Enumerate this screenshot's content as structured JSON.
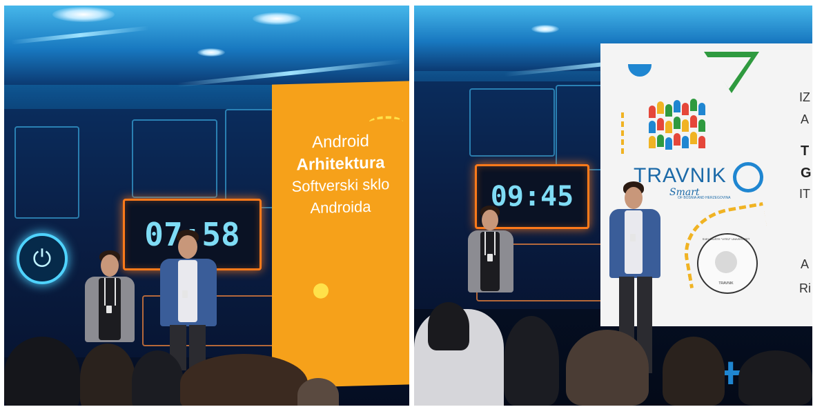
{
  "left_photo": {
    "timer_text": "07:58",
    "slide": {
      "line1": "Android",
      "line2": "Arhitektura",
      "line3": "Softverski sklo",
      "line4": "Androida"
    }
  },
  "right_photo": {
    "timer_text": "09:45",
    "slide": {
      "logo_name": "TRAVNIK",
      "logo_script": "Smart",
      "logo_tagline": "OF BOSNIA AND HERZEGOVINA",
      "seal_text": "SVEUČILIŠTE \"VITEZ\" UNIVERZITET",
      "seal_city": "TRAVNIK",
      "right_col": [
        "IZ",
        "A",
        "T",
        "G",
        "IT",
        "A",
        "Ri"
      ]
    }
  },
  "colors": {
    "stage_blue": "#0b3a72",
    "timer_border": "#ff7a1a",
    "timer_digits": "#7fdcf5",
    "slide_orange": "#f6a11a",
    "slide_white": "#f4f4f4",
    "logo_green": "#2f9a3f",
    "logo_blue": "#1f86d1"
  },
  "icons": [
    "power-standby-icon",
    "plus-icon",
    "circle-outline-icon",
    "triangle-outline-icon"
  ]
}
